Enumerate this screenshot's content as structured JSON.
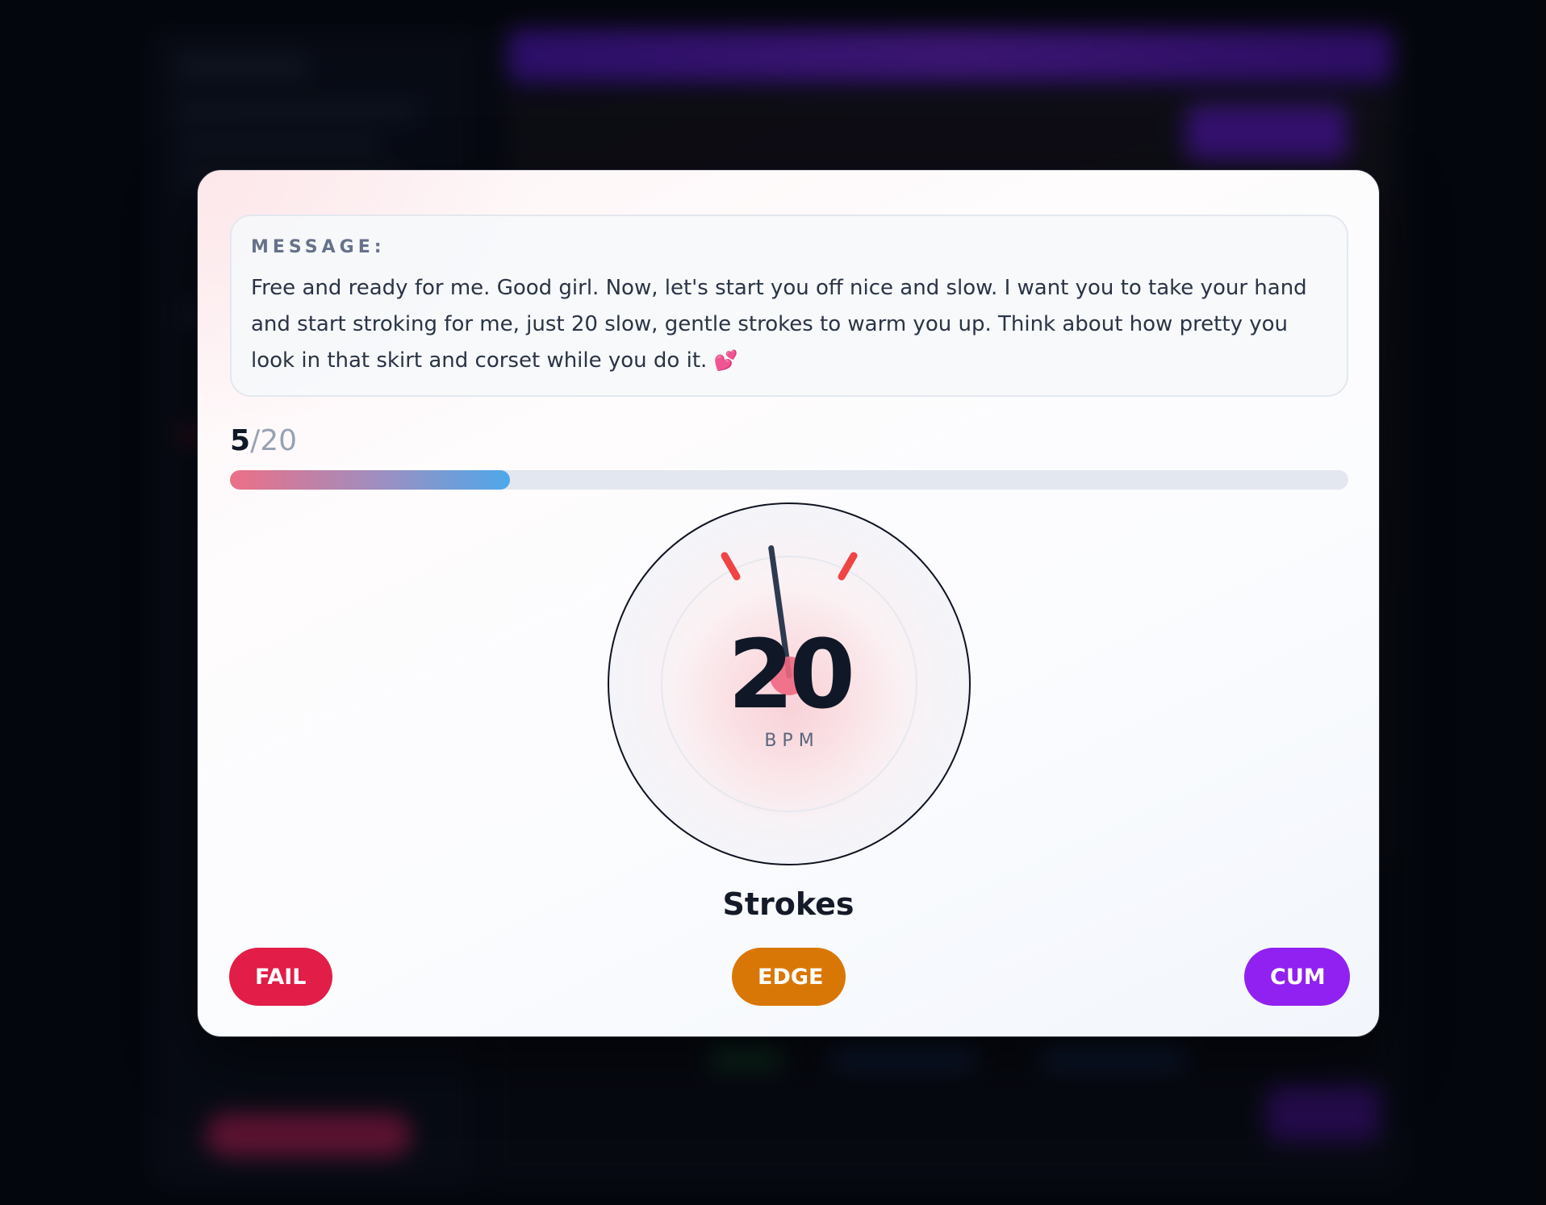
{
  "modal": {
    "message_label": "MESSAGE:",
    "message_text": "Free and ready for me. Good girl. Now, let's start you off nice and slow. I want you to take your hand and start stroking for me, just 20 slow, gentle strokes to warm you up. Think about how pretty you look in that skirt and corset while you do it.",
    "message_emoji": "💕",
    "progress": {
      "current": "5",
      "separator": "/",
      "total": "20",
      "fraction": 0.25
    },
    "dial": {
      "value": "20",
      "unit": "BPM",
      "needle_angle_deg": -8
    },
    "task_label": "Strokes",
    "buttons": {
      "fail": "FAIL",
      "edge": "EDGE",
      "cum": "CUM"
    }
  },
  "colors": {
    "fail": "#e11d48",
    "edge": "#d97706",
    "cum": "#9121f0",
    "tick": "#ef4444",
    "progress_start": "#ec6f86",
    "progress_end": "#4ea8ea"
  }
}
